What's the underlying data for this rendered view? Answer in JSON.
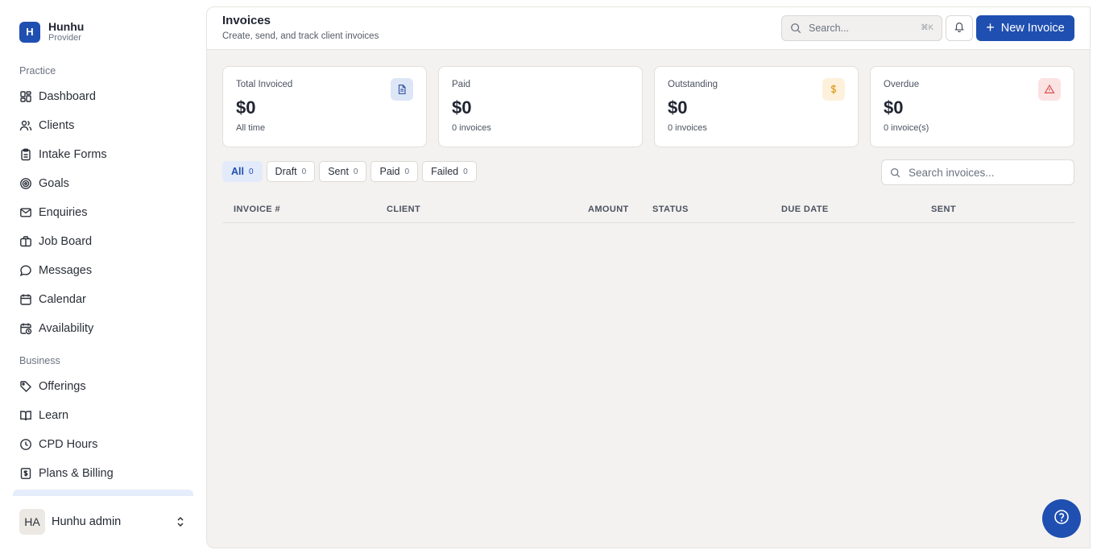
{
  "brand": {
    "logo_letter": "H",
    "name": "Hunhu",
    "role": "Provider"
  },
  "sidebar": {
    "sections": [
      {
        "label": "Practice"
      },
      {
        "label": "Business"
      }
    ],
    "items": [
      {
        "label": "Dashboard",
        "icon": "dashboard-icon"
      },
      {
        "label": "Clients",
        "icon": "users-icon"
      },
      {
        "label": "Intake Forms",
        "icon": "clipboard-icon"
      },
      {
        "label": "Goals",
        "icon": "target-icon"
      },
      {
        "label": "Enquiries",
        "icon": "mail-icon"
      },
      {
        "label": "Job Board",
        "icon": "briefcase-icon"
      },
      {
        "label": "Messages",
        "icon": "chat-icon"
      },
      {
        "label": "Calendar",
        "icon": "calendar-icon"
      },
      {
        "label": "Availability",
        "icon": "calendar-clock-icon"
      },
      {
        "label": "Offerings",
        "icon": "tag-icon"
      },
      {
        "label": "Learn",
        "icon": "book-icon"
      },
      {
        "label": "CPD Hours",
        "icon": "clock-icon"
      },
      {
        "label": "Plans & Billing",
        "icon": "receipt-icon"
      }
    ]
  },
  "user": {
    "initials": "HA",
    "name": "Hunhu admin"
  },
  "header": {
    "title": "Invoices",
    "subtitle": "Create, send, and track client invoices",
    "search_placeholder": "Search...",
    "search_shortcut": "⌘K",
    "new_button": "New Invoice"
  },
  "stats": [
    {
      "label": "Total Invoiced",
      "value": "$0",
      "note": "All time",
      "icon": "document-icon",
      "icon_color": "#3b5ba8",
      "icon_bg": "#dde6f7"
    },
    {
      "label": "Paid",
      "value": "$0",
      "note": "0 invoices"
    },
    {
      "label": "Outstanding",
      "value": "$0",
      "note": "0 invoices",
      "icon": "dollar-icon",
      "icon_color": "#e0a12b",
      "icon_bg": "#fdf1dc"
    },
    {
      "label": "Overdue",
      "value": "$0",
      "note": "0 invoice(s)",
      "icon": "alert-triangle-icon",
      "icon_color": "#d95454",
      "icon_bg": "#fbe3e3"
    }
  ],
  "tabs": [
    {
      "label": "All",
      "count": "0",
      "active": true
    },
    {
      "label": "Draft",
      "count": "0"
    },
    {
      "label": "Sent",
      "count": "0"
    },
    {
      "label": "Paid",
      "count": "0"
    },
    {
      "label": "Failed",
      "count": "0"
    }
  ],
  "invoice_search_placeholder": "Search invoices...",
  "table": {
    "columns": [
      "INVOICE #",
      "CLIENT",
      "AMOUNT",
      "STATUS",
      "DUE DATE",
      "SENT"
    ],
    "rows": []
  },
  "colors": {
    "accent": "#1f4fb0",
    "panel_bg": "#f3f2f0"
  }
}
